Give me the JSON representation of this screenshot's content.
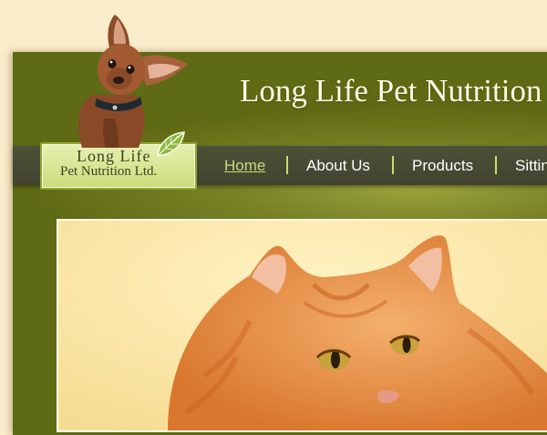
{
  "site": {
    "title": "Long Life Pet Nutrition",
    "logo_line1": "Long Life",
    "logo_line2": "Pet Nutrition Ltd."
  },
  "nav": {
    "items": [
      {
        "label": "Home",
        "active": true
      },
      {
        "label": "About Us",
        "active": false
      },
      {
        "label": "Products",
        "active": false
      },
      {
        "label": "Sitting",
        "active": false
      }
    ]
  },
  "colors": {
    "page_bg": "#fbeccc",
    "header_green": "#6b751b",
    "navbar": "#45472f",
    "nav_active": "#c7d97a",
    "separator": "#c8df6a"
  },
  "images": {
    "mascot": "dog-photo",
    "hero": "orange-cat-photo",
    "logo_icon": "leaf-icon"
  }
}
